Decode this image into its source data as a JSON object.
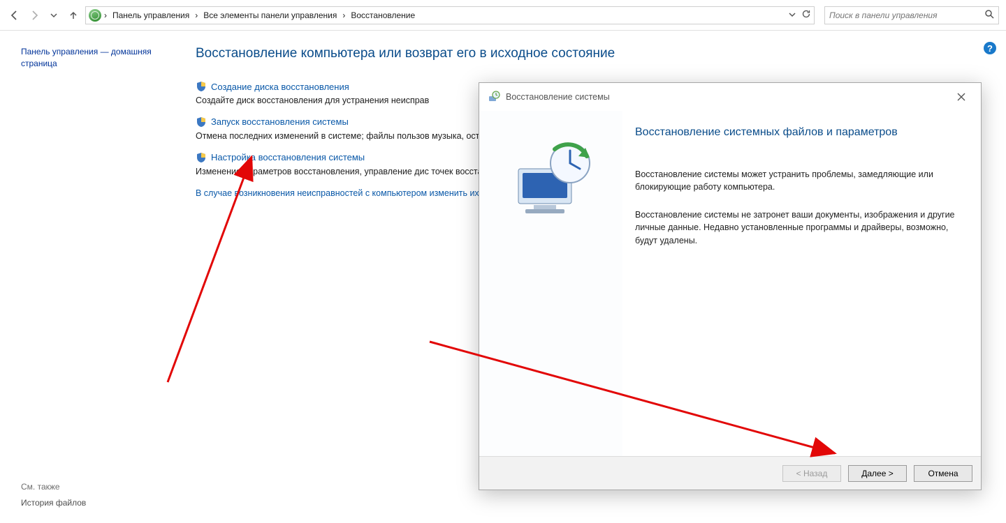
{
  "breadcrumb": {
    "items": [
      "Панель управления",
      "Все элементы панели управления",
      "Восстановление"
    ]
  },
  "search": {
    "placeholder": "Поиск в панели управления"
  },
  "sidebar": {
    "home_label": "Панель управления — домашняя страница",
    "see_also_hdr": "См. также",
    "see_also_item": "История файлов"
  },
  "page": {
    "title": "Восстановление компьютера или возврат его в исходное состояние",
    "items": [
      {
        "title": "Создание диска восстановления",
        "desc": "Создайте диск восстановления для устранения неисправ"
      },
      {
        "title": "Запуск восстановления системы",
        "desc": "Отмена последних изменений в системе; файлы пользов                               музыка, остаются без изменений."
      },
      {
        "title": "Настройка восстановления системы",
        "desc": "Изменение параметров восстановления, управление дис                                точек восстановления."
      }
    ],
    "advanced_link": "В случае возникновения неисправностей с компьютером                                изменить их."
  },
  "dialog": {
    "title": "Восстановление системы",
    "heading": "Восстановление системных файлов и параметров",
    "p1": "Восстановление системы может устранить проблемы, замедляющие или блокирующие работу компьютера.",
    "p2": "Восстановление системы не затронет ваши документы, изображения и другие личные данные. Недавно установленные программы и драйверы, возможно, будут удалены.",
    "btn_back": "< Назад",
    "btn_next": "Далее >",
    "btn_cancel": "Отмена"
  },
  "help_badge": "?"
}
